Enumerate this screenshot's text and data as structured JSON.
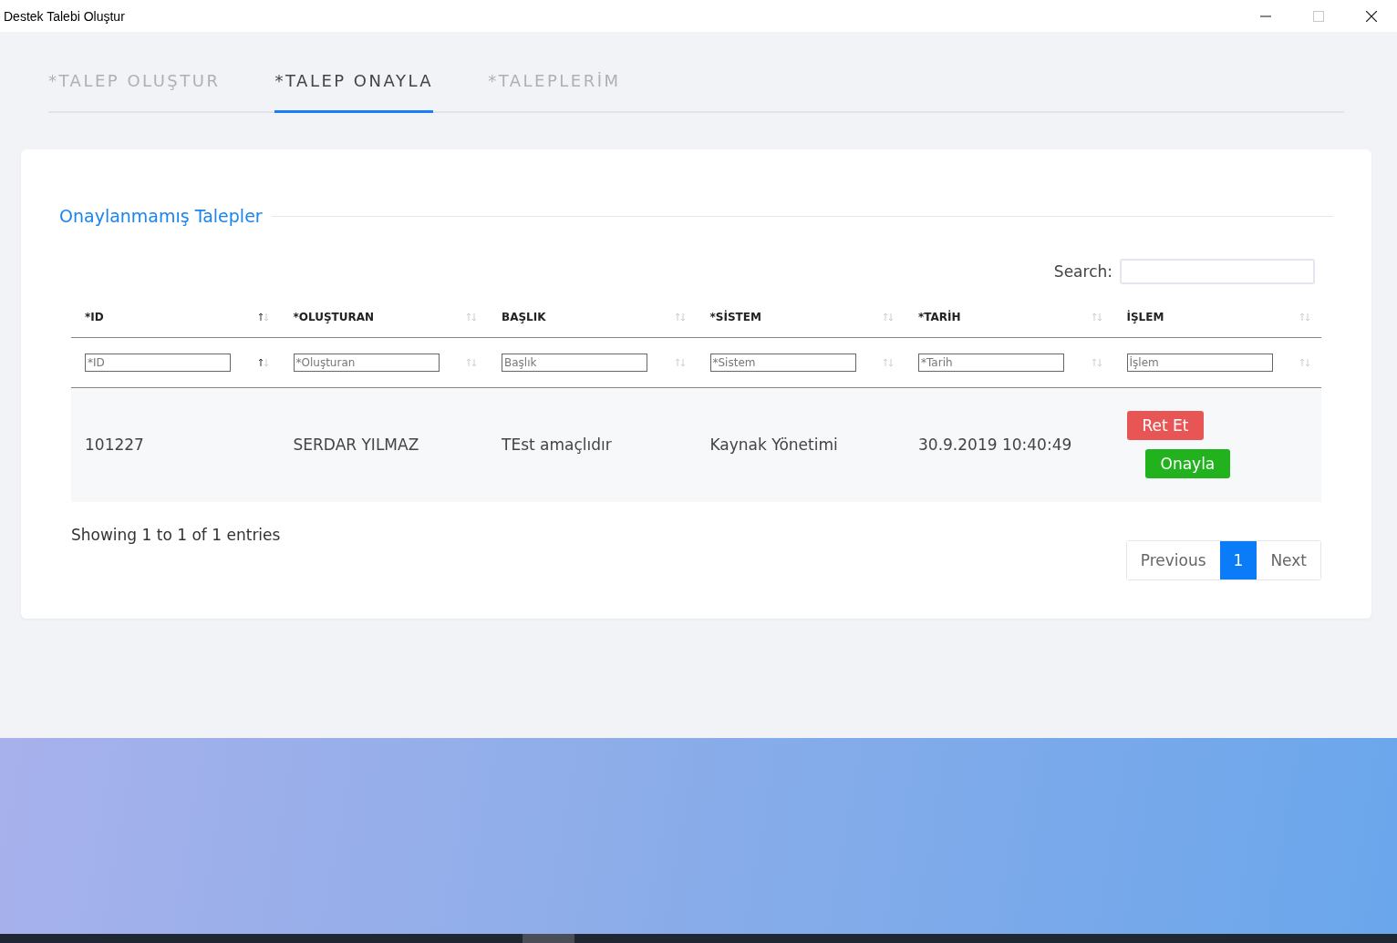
{
  "window": {
    "title": "Destek Talebi Oluştur",
    "maximize_disabled": true
  },
  "tabs": [
    {
      "label": "*TALEP OLUŞTUR",
      "selected": false
    },
    {
      "label": "*TALEP ONAYLA",
      "selected": true
    },
    {
      "label": "*TALEPLERİM",
      "selected": false
    }
  ],
  "section_title": "Onaylanmamış Talepler",
  "search": {
    "label": "Search:"
  },
  "table": {
    "columns": [
      {
        "label": "*ID",
        "sorted": true,
        "filter_placeholder": "*ID"
      },
      {
        "label": "*OLUŞTURAN",
        "sorted": false,
        "filter_placeholder": "*Oluşturan"
      },
      {
        "label": "BAŞLIK",
        "sorted": false,
        "filter_placeholder": "Başlık"
      },
      {
        "label": "*SİSTEM",
        "sorted": false,
        "filter_placeholder": "*Sistem"
      },
      {
        "label": "*TARİH",
        "sorted": false,
        "filter_placeholder": "*Tarih"
      },
      {
        "label": "İŞLEM",
        "sorted": false,
        "filter_placeholder": "İşlem"
      }
    ],
    "rows": [
      {
        "cells": [
          "101227",
          "SERDAR YILMAZ",
          "TEst amaçlıdır",
          "Kaynak Yönetimi",
          "30.9.2019 10:40:49"
        ],
        "actions": [
          {
            "label": "Ret Et",
            "kind": "reject"
          },
          {
            "label": "Onayla",
            "kind": "approve"
          }
        ]
      }
    ]
  },
  "info": "Showing 1 to 1 of 1 entries",
  "pagination": [
    {
      "label": "Previous",
      "selected": false
    },
    {
      "label": "1",
      "selected": true
    },
    {
      "label": "Next",
      "selected": false
    }
  ]
}
